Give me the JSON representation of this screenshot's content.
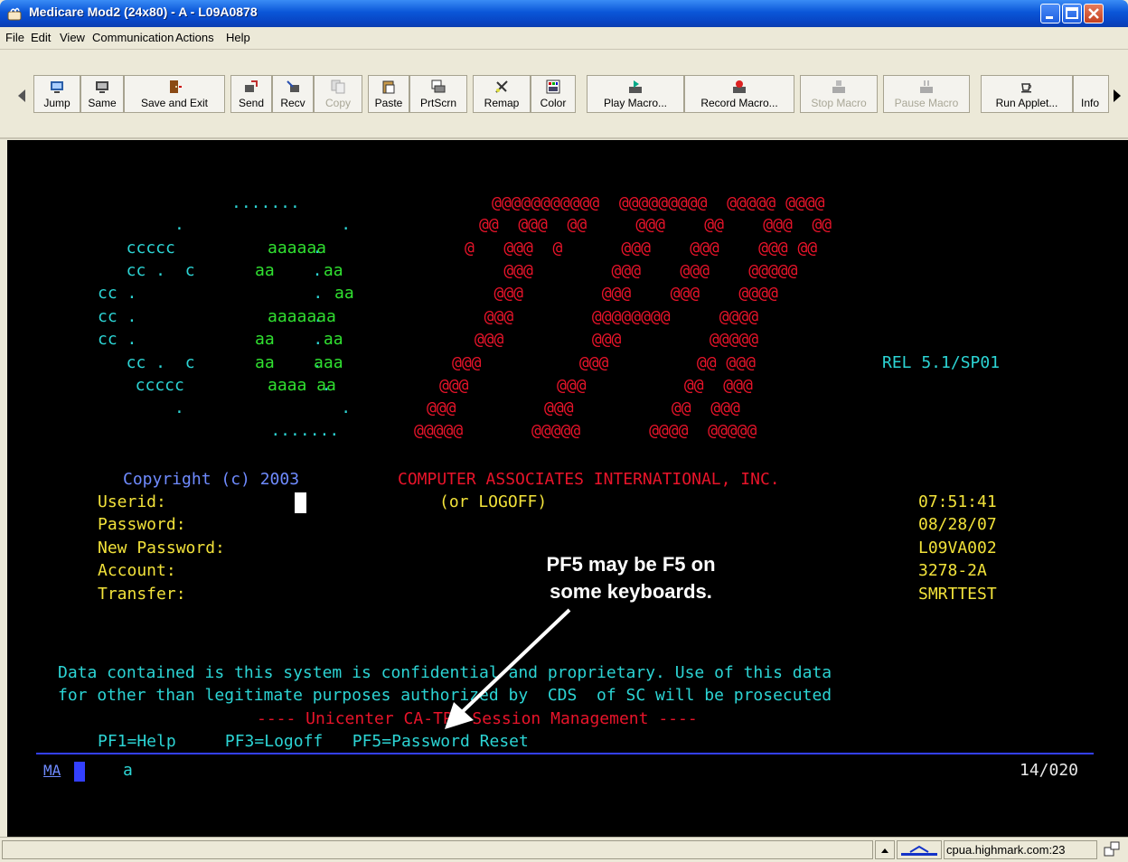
{
  "window": {
    "title": "Medicare Mod2 (24x80) - A - L09A0878"
  },
  "menu": [
    "File",
    "Edit",
    "View",
    "Communication",
    "Actions",
    "Help"
  ],
  "toolbar": {
    "buttons": [
      {
        "label": "Jump",
        "enabled": true
      },
      {
        "label": "Same",
        "enabled": true
      },
      {
        "label": "Save and Exit",
        "enabled": true
      },
      {
        "label": "Send",
        "enabled": true
      },
      {
        "label": "Recv",
        "enabled": true
      },
      {
        "label": "Copy",
        "enabled": false
      },
      {
        "label": "Paste",
        "enabled": true
      },
      {
        "label": "PrtScrn",
        "enabled": true
      },
      {
        "label": "Remap",
        "enabled": true
      },
      {
        "label": "Color",
        "enabled": true
      },
      {
        "label": "Play Macro...",
        "enabled": true
      },
      {
        "label": "Record Macro...",
        "enabled": true
      },
      {
        "label": "Stop Macro",
        "enabled": false
      },
      {
        "label": "Pause Macro",
        "enabled": false
      },
      {
        "label": "Run Applet...",
        "enabled": true
      },
      {
        "label": "Info",
        "enabled": true
      }
    ]
  },
  "terminal": {
    "logo": {
      "cyan_dots_top": ".......",
      "cyan_rows": [
        "      .                .",
        "  ccccc              .",
        "  cc .  c            .",
        "cc .                  .",
        "cc .                  .",
        "cc .                  .",
        "  cc .  c            .",
        "  ccccc              .",
        "      .                .",
        "    ......."
      ],
      "green_rows": [
        "aaaaaa",
        "aa     aa",
        "aa",
        "aaaaaaa",
        "aa     aa",
        "aa    aaa",
        "aaaa aa"
      ],
      "red_rows": [
        "@@@@@@@@@@@  @@@@@@@@@  @@@@@ @@@@",
        "@@  @@@  @@     @@@    @@    @@@  @@",
        "@   @@@  @      @@@    @@@    @@@ @@",
        "    @@@        @@@    @@@    @@@@@",
        "   @@@        @@@    @@@    @@@@",
        "  @@@        @@@@@@@@     @@@@",
        " @@@         @@@         @@@@@",
        "@@@          @@@         @@ @@@",
        "@@@         @@@          @@  @@@",
        "@@@         @@@          @@  @@@",
        "@@@@@       @@@@@       @@@@  @@@@@"
      ],
      "release": "REL 5.1/SP01"
    },
    "copyright": "Copyright (c) 2003",
    "company": "COMPUTER ASSOCIATES INTERNATIONAL, INC.",
    "fields": [
      {
        "label": "Userid:",
        "hint": "(or LOGOFF)",
        "right": "07:51:41"
      },
      {
        "label": "Password:",
        "right": "08/28/07"
      },
      {
        "label": "New Password:",
        "right": "L09VA002"
      },
      {
        "label": "Account:",
        "right": "3278-2A"
      },
      {
        "label": "Transfer:",
        "right": "SMRTTEST"
      }
    ],
    "annotation": [
      "PF5 may be F5 on",
      "some keyboards."
    ],
    "notice_line1": "Data contained is this system is confidential and proprietary. Use of this data",
    "notice_line2": "for other than legitimate purposes authorized by  CDS  of SC will be prosecuted",
    "session_title": "---- Unicenter CA-TPX Session Management ----",
    "pf_keys": "PF1=Help     PF3=Logoff   PF5=Password Reset",
    "oia_left": "MA",
    "oia_mid": "a",
    "oia_right": "14/020"
  },
  "status": {
    "host": "cpua.highmark.com:23"
  },
  "colors": {
    "red": "#e8142a",
    "cyan": "#2cd4d4",
    "green": "#30e030",
    "yellow": "#f2e23a",
    "blue": "#3340ff"
  }
}
